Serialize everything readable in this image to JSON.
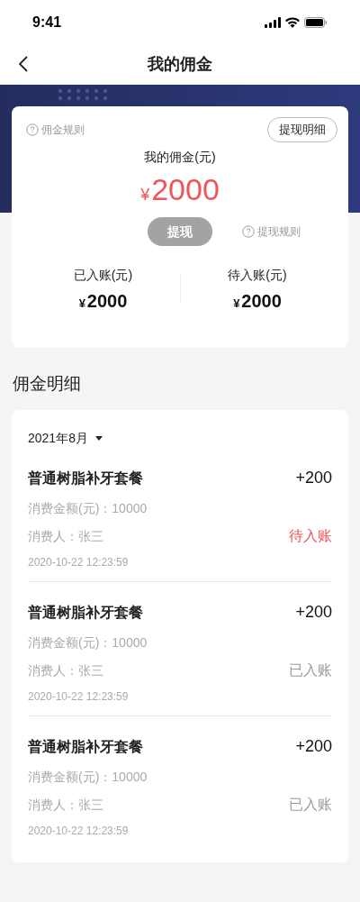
{
  "status_bar": {
    "time": "9:41"
  },
  "nav": {
    "title": "我的佣金"
  },
  "summary": {
    "rules_link": "佣金规则",
    "details_button": "提现明细",
    "label": "我的佣金(元)",
    "currency": "¥",
    "amount": "2000",
    "withdraw_button": {
      "label": "提现",
      "disabled": true
    },
    "withdraw_rules": "提现规则",
    "stats": [
      {
        "label": "已入账(元)",
        "currency": "¥",
        "amount": "2000"
      },
      {
        "label": "待入账(元)",
        "currency": "¥",
        "amount": "2000"
      }
    ]
  },
  "section_title": "佣金明细",
  "filter": {
    "month": "2021年8月"
  },
  "records": [
    {
      "title": "普通树脂补牙套餐",
      "amount": "+200",
      "spend": "消费金额(元)：10000",
      "customer": "消费人：张三",
      "time": "2020-10-22  12:23:59",
      "status": "待入账",
      "kind": "pending"
    },
    {
      "title": "普通树脂补牙套餐",
      "amount": "+200",
      "spend": "消费金额(元)：10000",
      "customer": "消费人：张三",
      "time": "2020-10-22  12:23:59",
      "status": "已入账",
      "kind": "settled"
    },
    {
      "title": "普通树脂补牙套餐",
      "amount": "+200",
      "spend": "消费金额(元)：10000",
      "customer": "消费人：张三",
      "time": "2020-10-22  12:23:59",
      "status": "已入账",
      "kind": "settled"
    }
  ]
}
